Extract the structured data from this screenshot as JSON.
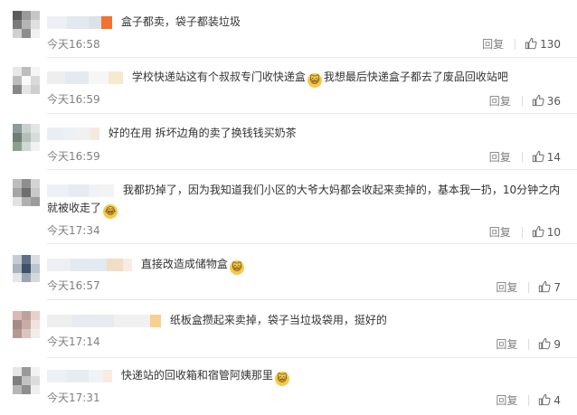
{
  "comments": [
    {
      "text": "盒子都卖，袋子都装垃圾",
      "emoji": "",
      "time": "今天16:58",
      "reply": "回复",
      "likes": "130",
      "name_colors": [
        "#eceff3",
        "#e2e9f1",
        "#dbe2ea",
        "#f0732f"
      ],
      "avatar_colors": [
        "#5c5c5c",
        "#9a9a9a",
        "#c6c6c6",
        "#7a7a7a",
        "#b5b5b5",
        "#e0e0e0",
        "#d0d0d0",
        "#8d8d8d",
        "#f0f0f0"
      ]
    },
    {
      "text": "学校快递站这有个叔叔专门收快递盒",
      "emoji": "😺",
      "text2": "我想最后快递盒子都去了废品回收站吧",
      "time": "今天16:59",
      "reply": "回复",
      "likes": "36",
      "name_colors": [
        "#eeeeee",
        "#e4eaf0",
        "#f6f6f6",
        "#f5e9d2"
      ],
      "avatar_colors": [
        "#e8e8e8",
        "#bdbdbd",
        "#f5f5f5",
        "#bcbcbc",
        "#fafafa",
        "#d9d9d9",
        "#888888",
        "#e5e5e5",
        "#cfcfcf"
      ]
    },
    {
      "text": "好的在用 拆坏边角的卖了换钱钱买奶茶",
      "emoji": "",
      "time": "今天16:59",
      "reply": "回复",
      "likes": "14",
      "name_colors": [
        "#e9eef2",
        "#eef1f4",
        "#f1f1f1",
        "#f4eadb"
      ],
      "avatar_colors": [
        "#8c9a9a",
        "#c9d0cf",
        "#e1e5e4",
        "#6f7d77",
        "#b4bdb8",
        "#d6dcd9",
        "#8aa28f",
        "#cfd8d2",
        "#f0f2f1"
      ]
    },
    {
      "text": "我都扔掉了，因为我知道我们小区的大爷大妈都会收起来卖掉的，基本我一扔，10分钟之内就被收走了",
      "emoji": "😂",
      "time": "今天17:34",
      "reply": "回复",
      "likes": "10",
      "name_colors": [
        "#edf0f4",
        "#e6ebf1",
        "#f0f2f5",
        "#f3f3f3"
      ],
      "avatar_colors": [
        "#bdbdbd",
        "#8f8f8f",
        "#d4d4d4",
        "#a5a5a5",
        "#6e6e6e",
        "#c9c9c9",
        "#e2e2e2",
        "#b0b0b0",
        "#9c9c9c"
      ]
    },
    {
      "text": "直接改造成储物盒",
      "emoji": "😺",
      "time": "今天16:57",
      "reply": "回复",
      "likes": "7",
      "name_colors": [
        "#eceff3",
        "#e3e9f0",
        "#f2ddc6",
        "#f7ecdf"
      ],
      "avatar_colors": [
        "#c7ccd3",
        "#5f6f84",
        "#d9dde2",
        "#a9b3bf",
        "#3f5068",
        "#bcc4cd",
        "#e3e6ea",
        "#9aa5b2",
        "#d3d8dd"
      ]
    },
    {
      "text": "纸板盒攒起来卖掉，袋子当垃圾袋用，挺好的",
      "emoji": "",
      "time": "今天17:14",
      "reply": "回复",
      "likes": "9",
      "name_colors": [
        "#eeeeee",
        "#e7ebef",
        "#f1f1f1",
        "#f8cf8f"
      ],
      "avatar_colors": [
        "#d9b9b4",
        "#bfa19c",
        "#e6d1cd",
        "#a48b87",
        "#c9aca7",
        "#efe2df",
        "#b59893",
        "#dcc5c1",
        "#f4ecea"
      ]
    },
    {
      "text": "快递站的回收箱和宿管阿姨那里",
      "emoji": "😺",
      "time": "今天17:31",
      "reply": "回复",
      "likes": "4",
      "name_colors": [
        "#edf0f4",
        "#e7ecf1",
        "#f0f3f6",
        "#f7edde"
      ],
      "avatar_colors": [
        "#e6e6e6",
        "#9a9a9a",
        "#f2f2f2",
        "#7f7f7f",
        "#c2c2c2",
        "#dcdcdc",
        "#b6b6b6",
        "#8f8f8f",
        "#efefef"
      ]
    }
  ]
}
